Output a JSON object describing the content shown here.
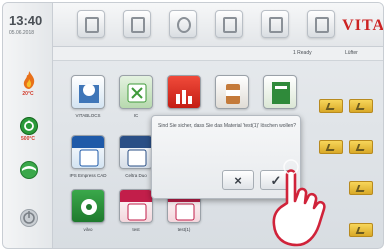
{
  "status": {
    "time": "13:40",
    "date": "05.06.2018",
    "temp_top": "20°C",
    "temp_vacuum": "500°C"
  },
  "brand": "VITA",
  "subbar": {
    "ready_label": "1 Ready",
    "lufter_label": "Lüfter"
  },
  "tiles": [
    {
      "label": "VITABLOCS"
    },
    {
      "label": "IC"
    },
    {
      "label": ""
    },
    {
      "label": ""
    },
    {
      "label": "IPS Empress CAD"
    },
    {
      "label": "Celtra Duo"
    },
    {
      "label": "vilvo"
    },
    {
      "label": "test"
    },
    {
      "label": "test(1)"
    }
  ],
  "dialog": {
    "message": "Sind Sie sicher, dass Sie das Material 'test(1)' löschen wollen?",
    "cancel_symbol": "×",
    "confirm_symbol": "✓"
  },
  "icons": {
    "flame": "flame-icon",
    "vacuum": "vacuum-icon",
    "cooling": "cooling-icon",
    "power": "power-icon"
  }
}
